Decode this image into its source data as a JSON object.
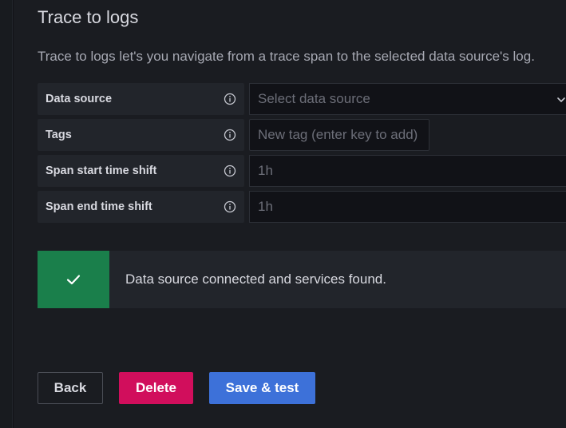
{
  "section": {
    "title": "Trace to logs",
    "description": "Trace to logs let's you navigate from a trace span to the selected data source's log."
  },
  "fields": [
    {
      "label": "Data source",
      "value": "",
      "placeholder": "Select data source"
    },
    {
      "label": "Tags",
      "value": "",
      "placeholder": "New tag (enter key to add)"
    },
    {
      "label": "Span start time shift",
      "value": "",
      "placeholder": "1h"
    },
    {
      "label": "Span end time shift",
      "value": "",
      "placeholder": "1h"
    }
  ],
  "alert": {
    "status": "success",
    "message": "Data source connected and services found.",
    "color": "#1a7f4b"
  },
  "buttons": {
    "back": "Back",
    "delete": "Delete",
    "save": "Save & test"
  },
  "colors": {
    "danger": "#d10e5c",
    "primary": "#3d71d9",
    "success": "#1a7f4b"
  }
}
